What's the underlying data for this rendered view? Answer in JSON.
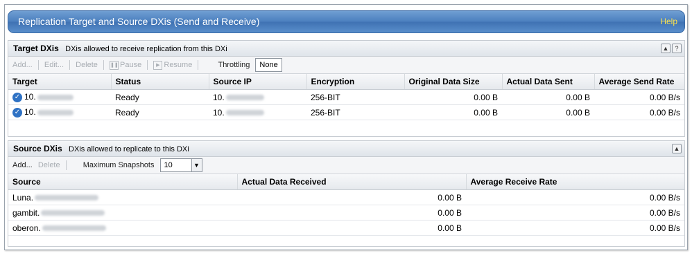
{
  "header": {
    "title": "Replication Target and Source DXis (Send and Receive)",
    "help": "Help"
  },
  "target": {
    "title": "Target DXis",
    "description": "DXis allowed to receive replication from this DXi",
    "toolbar": {
      "add": "Add...",
      "edit": "Edit...",
      "delete": "Delete",
      "pause": "Pause",
      "resume": "Resume",
      "throttling_label": "Throttling",
      "throttling_value": "None"
    },
    "columns": [
      "Target",
      "Status",
      "Source IP",
      "Encryption",
      "Original Data Size",
      "Actual Data Sent",
      "Average Send Rate"
    ],
    "rows": [
      {
        "target": "10.",
        "status": "Ready",
        "source_ip": "10.",
        "encryption": "256-BIT",
        "original": "0.00 B",
        "sent": "0.00 B",
        "rate": "0.00 B/s"
      },
      {
        "target": "10.",
        "status": "Ready",
        "source_ip": "10.",
        "encryption": "256-BIT",
        "original": "0.00 B",
        "sent": "0.00 B",
        "rate": "0.00 B/s"
      }
    ]
  },
  "source": {
    "title": "Source DXis",
    "description": "DXis allowed to replicate to this DXi",
    "toolbar": {
      "add": "Add...",
      "delete": "Delete",
      "max_snapshots_label": "Maximum Snapshots",
      "max_snapshots_value": "10"
    },
    "columns": [
      "Source",
      "Actual Data Received",
      "Average Receive Rate"
    ],
    "rows": [
      {
        "source": "Luna.",
        "received": "0.00 B",
        "rate": "0.00 B/s"
      },
      {
        "source": "gambit.",
        "received": "0.00 B",
        "rate": "0.00 B/s"
      },
      {
        "source": "oberon.",
        "received": "0.00 B",
        "rate": "0.00 B/s"
      }
    ]
  }
}
